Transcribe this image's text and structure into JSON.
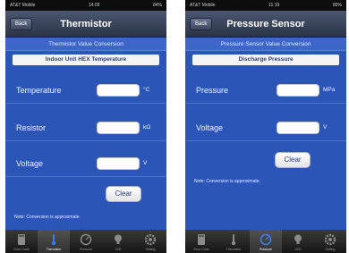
{
  "left": {
    "status": {
      "carrier": "AT&T Mobile",
      "time": "14:09",
      "battery": "84%"
    },
    "nav": {
      "back_label": "Back",
      "title": "Thermistor"
    },
    "subtitle": "Thermistor Value Conversion",
    "section": "Indoor Unit HEX Temperature",
    "rows": [
      {
        "label": "Temperature",
        "value": "",
        "unit": "°C"
      },
      {
        "label": "Resistor",
        "value": "",
        "unit": "kΩ"
      },
      {
        "label": "Voltage",
        "value": "",
        "unit": "V"
      }
    ],
    "clear_label": "Clear",
    "note": "Note: Conversion is approximate.",
    "tabs": [
      {
        "label": "Error Code",
        "icon": "book-icon",
        "active": false
      },
      {
        "label": "Thermistor",
        "icon": "thermometer-icon",
        "active": true
      },
      {
        "label": "Pressure",
        "icon": "gauge-icon",
        "active": false
      },
      {
        "label": "LED",
        "icon": "lightbulb-icon",
        "active": false
      },
      {
        "label": "Setting",
        "icon": "gear-icon",
        "active": false
      }
    ]
  },
  "right": {
    "status": {
      "carrier": "AT&T Mobile",
      "time": "11:19",
      "battery": "85%"
    },
    "nav": {
      "back_label": "Back",
      "title": "Pressure Sensor"
    },
    "subtitle": "Pressure Sensor Value Conversion",
    "section": "Discharge Pressure",
    "rows": [
      {
        "label": "Pressure",
        "value": "",
        "unit": "MPa"
      },
      {
        "label": "Voltage",
        "value": "",
        "unit": "V"
      }
    ],
    "clear_label": "Clear",
    "note": "Note: Conversion is approximate.",
    "tabs": [
      {
        "label": "Error Code",
        "icon": "book-icon",
        "active": false
      },
      {
        "label": "Thermistor",
        "icon": "thermometer-icon",
        "active": false
      },
      {
        "label": "Pressure",
        "icon": "gauge-icon",
        "active": true
      },
      {
        "label": "LED",
        "icon": "lightbulb-icon",
        "active": false
      },
      {
        "label": "Setting",
        "icon": "gear-icon",
        "active": false
      }
    ]
  },
  "colors": {
    "screen_bg": "#2c55b8",
    "nav_bg": "#2a3347",
    "tab_bar_bg": "#151515"
  }
}
